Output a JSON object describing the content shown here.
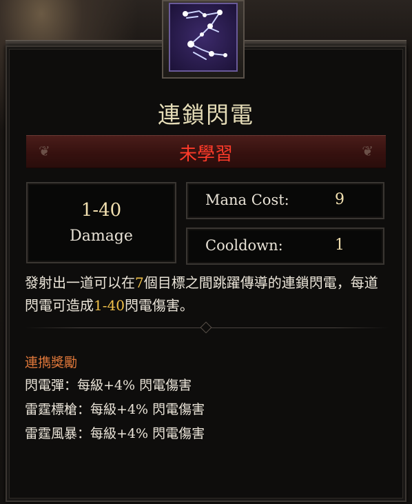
{
  "skill": {
    "name": "連鎖閃電",
    "status": "未學習",
    "damage_value": "1-40",
    "damage_label": "Damage",
    "mana_label": "Mana Cost:",
    "mana_value": "9",
    "cooldown_label": "Cooldown:",
    "cooldown_value": "1",
    "description": {
      "p1": "發射出一道可以在",
      "hl1": "7",
      "p2": "個目標之間跳躍傳導的連鎖閃電，每道閃電可造成",
      "hl2": "1-40",
      "p3": "閃電傷害。"
    }
  },
  "synergy": {
    "title": "連擕獎勵",
    "lines": [
      "閃電彈：每級+4% 閃電傷害",
      "雷霆標槍：每級+4% 閃電傷害",
      "雷霆風暴：每級+4% 閃電傷害"
    ]
  },
  "colors": {
    "title": "#e6ddb8",
    "status": "#ff3b2a",
    "highlight": "#f2c24a",
    "synergy_title": "#e0783a"
  },
  "icons": {
    "skill_icon": "chain-lightning-icon"
  }
}
